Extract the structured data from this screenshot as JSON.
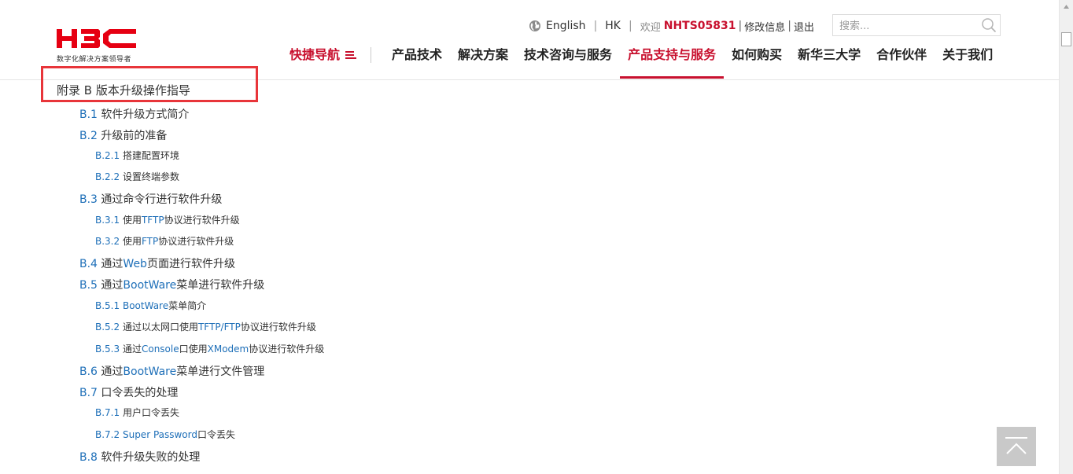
{
  "brand": {
    "logo_text": "H3C",
    "tagline": "数字化解决方案领导者",
    "logo_color": "#e60012"
  },
  "topbar": {
    "language": "English",
    "region": "HK",
    "welcome": "欢迎",
    "username": "NHTS05831",
    "edit_info": "修改信息",
    "logout": "退出",
    "separator": "|"
  },
  "search": {
    "placeholder": "搜索..."
  },
  "nav": {
    "quick_nav": "快捷导航",
    "items": [
      {
        "label": "产品技术"
      },
      {
        "label": "解决方案"
      },
      {
        "label": "技术咨询与服务"
      },
      {
        "label": "产品支持与服务"
      },
      {
        "label": "如何购买"
      },
      {
        "label": "新华三大学"
      },
      {
        "label": "合作伙伴"
      },
      {
        "label": "关于我们"
      }
    ],
    "active_index": 3,
    "active_color": "#c8102e"
  },
  "toc": {
    "title_num": "附录 B",
    "title_text": " 版本升级操作指导",
    "highlight_color": "#e8353a",
    "link_color": "#1e6fb8",
    "items": [
      {
        "num": "B.1",
        "text": " 软件升级方式简介"
      },
      {
        "num": "B.2",
        "text": " 升级前的准备"
      },
      {
        "num": "B.2.1",
        "text": " 搭建配置环境"
      },
      {
        "num": "B.2.2",
        "text": " 设置终端参数"
      },
      {
        "num": "B.3",
        "text": " 通过命令行进行软件升级"
      },
      {
        "num": "B.3.1",
        "pre": " 使用",
        "en": "TFTP",
        "post": "协议进行软件升级"
      },
      {
        "num": "B.3.2",
        "pre": " 使用",
        "en": "FTP",
        "post": "协议进行软件升级"
      },
      {
        "num": "B.4",
        "pre": " 通过",
        "en": "Web",
        "post": "页面进行软件升级"
      },
      {
        "num": "B.5",
        "pre": " 通过",
        "en": "BootWare",
        "post": "菜单进行软件升级"
      },
      {
        "num": "B.5.1",
        "pre": " ",
        "en": "BootWare",
        "post": "菜单简介"
      },
      {
        "num": "B.5.2",
        "pre": " 通过以太网口使用",
        "en": "TFTP/FTP",
        "post": "协议进行软件升级"
      },
      {
        "num": "B.5.3",
        "pre": " 通过",
        "en": "Console",
        "post": "口使用",
        "en2": "XModem",
        "post2": "协议进行软件升级"
      },
      {
        "num": "B.6",
        "pre": " 通过",
        "en": "BootWare",
        "post": "菜单进行文件管理"
      },
      {
        "num": "B.7",
        "text": " 口令丢失的处理"
      },
      {
        "num": "B.7.1",
        "text": " 用户口令丢失"
      },
      {
        "num": "B.7.2",
        "pre": " ",
        "en": "Super Password",
        "post": "口令丢失"
      },
      {
        "num": "B.8",
        "text": " 软件升级失败的处理"
      }
    ]
  },
  "icons": {
    "globe": "globe-icon",
    "menu": "menu-icon",
    "search": "search-icon",
    "back_to_top": "arrow-up-icon"
  }
}
